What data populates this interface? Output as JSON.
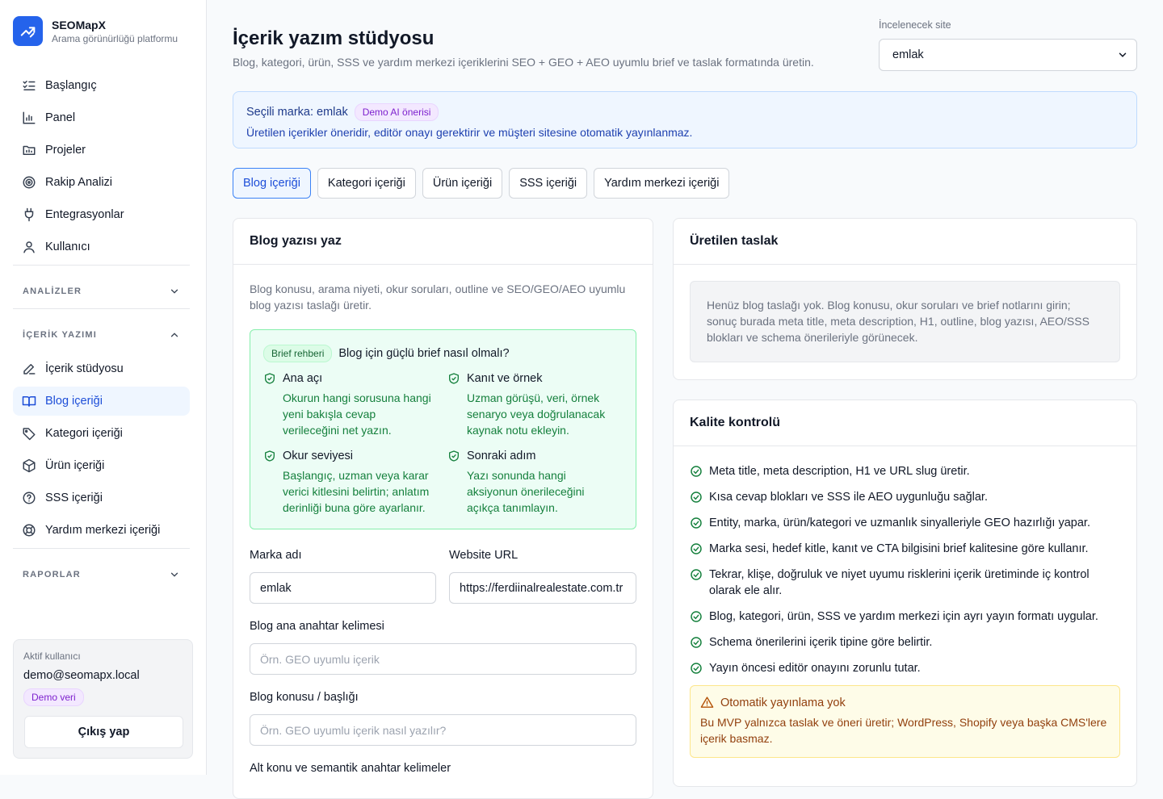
{
  "brand": {
    "name": "SEOMapX",
    "tagline": "Arama görünürlüğü platformu"
  },
  "nav": {
    "main": [
      {
        "label": "Başlangıç",
        "icon": "checklist-icon"
      },
      {
        "label": "Panel",
        "icon": "bar-chart-icon"
      },
      {
        "label": "Projeler",
        "icon": "folder-icon"
      },
      {
        "label": "Rakip Analizi",
        "icon": "target-icon"
      },
      {
        "label": "Entegrasyonlar",
        "icon": "plug-icon"
      },
      {
        "label": "Kullanıcı",
        "icon": "user-icon"
      }
    ],
    "sections": {
      "analyses": "ANALİZLER",
      "content": "İÇERİK YAZIMI",
      "reports": "RAPORLAR"
    },
    "content_items": [
      {
        "label": "İçerik stüdyosu",
        "icon": "pencil-icon"
      },
      {
        "label": "Blog içeriği",
        "icon": "book-icon",
        "active": true
      },
      {
        "label": "Kategori içeriği",
        "icon": "tag-icon"
      },
      {
        "label": "Ürün içeriği",
        "icon": "box-icon"
      },
      {
        "label": "SSS içeriği",
        "icon": "question-icon"
      },
      {
        "label": "Yardım merkezi içeriği",
        "icon": "lifebuoy-icon"
      }
    ]
  },
  "user": {
    "label": "Aktif kullanıcı",
    "email": "demo@seomapx.local",
    "badge": "Demo veri",
    "logout": "Çıkış yap"
  },
  "header": {
    "title": "İçerik yazım stüdyosu",
    "subtitle": "Blog, kategori, ürün, SSS ve yardım merkezi içeriklerini SEO + GEO + AEO uyumlu brief ve taslak formatında üretin.",
    "site_label": "İncelenecek site",
    "site_value": "emlak"
  },
  "notice": {
    "title": "Seçili marka: emlak",
    "badge": "Demo AI önerisi",
    "text": "Üretilen içerikler öneridir, editör onayı gerektirir ve müşteri sitesine otomatik yayınlanmaz."
  },
  "tabs": [
    "Blog içeriği",
    "Kategori içeriği",
    "Ürün içeriği",
    "SSS içeriği",
    "Yardım merkezi içeriği"
  ],
  "form": {
    "title": "Blog yazısı yaz",
    "description": "Blog konusu, arama niyeti, okur soruları, outline ve SEO/GEO/AEO uyumlu blog yazısı taslağı üretir.",
    "guide": {
      "badge": "Brief rehberi",
      "title": "Blog için güçlü brief nasıl olmalı?",
      "items": [
        {
          "title": "Ana açı",
          "text": "Okurun hangi sorusuna hangi yeni bakışla cevap verileceğini net yazın."
        },
        {
          "title": "Kanıt ve örnek",
          "text": "Uzman görüşü, veri, örnek senaryo veya doğrulanacak kaynak notu ekleyin."
        },
        {
          "title": "Okur seviyesi",
          "text": "Başlangıç, uzman veya karar verici kitlesini belirtin; anlatım derinliği buna göre ayarlanır."
        },
        {
          "title": "Sonraki adım",
          "text": "Yazı sonunda hangi aksiyonun önerileceğini açıkça tanımlayın."
        }
      ]
    },
    "brand_label": "Marka adı",
    "brand_value": "emlak",
    "url_label": "Website URL",
    "url_value": "https://ferdiinalrealestate.com.tr",
    "keyword_label": "Blog ana anahtar kelimesi",
    "keyword_placeholder": "Örn. GEO uyumlu içerik",
    "topic_label": "Blog konusu / başlığı",
    "topic_placeholder": "Örn. GEO uyumlu içerik nasıl yazılır?",
    "sub_label": "Alt konu ve semantik anahtar kelimeler"
  },
  "draft": {
    "title": "Üretilen taslak",
    "empty": "Henüz blog taslağı yok. Blog konusu, okur soruları ve brief notlarını girin; sonuç burada meta title, meta description, H1, outline, blog yazısı, AEO/SSS blokları ve schema önerileriyle görünecek."
  },
  "quality": {
    "title": "Kalite kontrolü",
    "items": [
      "Meta title, meta description, H1 ve URL slug üretir.",
      "Kısa cevap blokları ve SSS ile AEO uygunluğu sağlar.",
      "Entity, marka, ürün/kategori ve uzmanlık sinyalleriyle GEO hazırlığı yapar.",
      "Marka sesi, hedef kitle, kanıt ve CTA bilgisini brief kalitesine göre kullanır.",
      "Tekrar, klişe, doğruluk ve niyet uyumu risklerini içerik üretiminde iç kontrol olarak ele alır.",
      "Blog, kategori, ürün, SSS ve yardım merkezi için ayrı yayın formatı uygular.",
      "Schema önerilerini içerik tipine göre belirtir.",
      "Yayın öncesi editör onayını zorunlu tutar."
    ],
    "warning_title": "Otomatik yayınlama yok",
    "warning_text": "Bu MVP yalnızca taslak ve öneri üretir; WordPress, Shopify veya başka CMS'lere içerik basmaz."
  }
}
